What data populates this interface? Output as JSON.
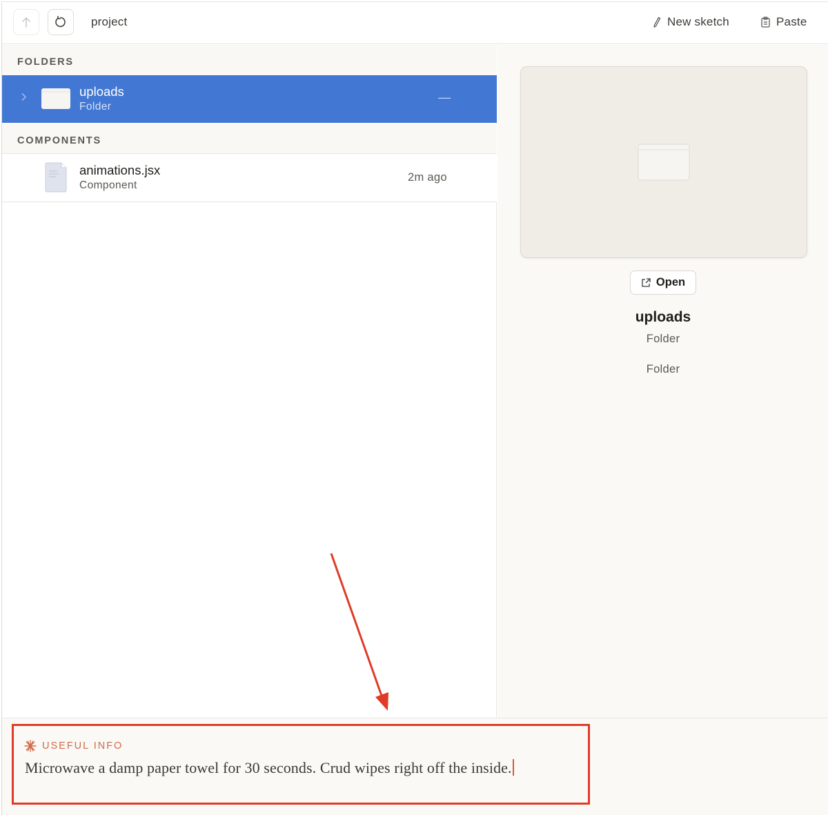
{
  "toolbar": {
    "path": "project",
    "new_sketch_label": "New sketch",
    "paste_label": "Paste"
  },
  "sections": {
    "folders": "FOLDERS",
    "components": "COMPONENTS"
  },
  "folders": [
    {
      "name": "uploads",
      "type": "Folder",
      "trailing": "—",
      "selected": true
    }
  ],
  "components": [
    {
      "name": "animations.jsx",
      "type": "Component",
      "modified": "2m ago"
    }
  ],
  "details": {
    "open_label": "Open",
    "name": "uploads",
    "type": "Folder",
    "kind": "Folder"
  },
  "info": {
    "label": "USEFUL INFO",
    "text": "Microwave a damp paper towel for 30 seconds. Crud wipes right off the inside."
  },
  "colors": {
    "selection": "#4277d4",
    "highlight_box": "#df3b26",
    "annotation_arrow": "#df3b26",
    "info_accent": "#cf6b4a"
  }
}
